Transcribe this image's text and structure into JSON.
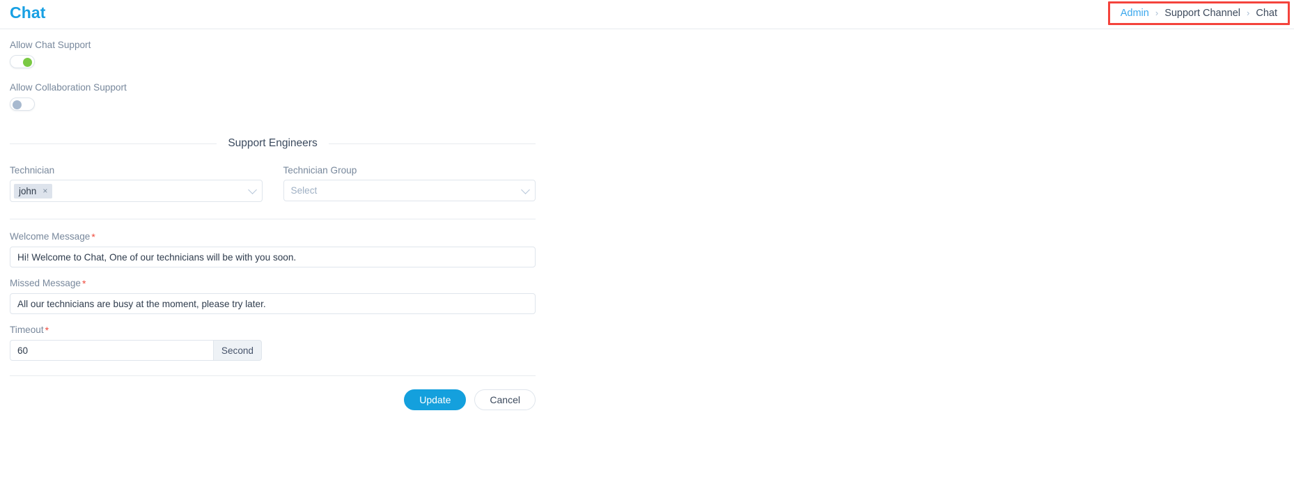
{
  "header": {
    "title": "Chat",
    "breadcrumb": {
      "items": [
        "Admin",
        "Support Channel",
        "Chat"
      ],
      "separator": "›",
      "highlight_color": "#f4433c",
      "link_color": "#39a7ed"
    }
  },
  "toggles": {
    "chat_support": {
      "label": "Allow Chat Support",
      "state": "on",
      "on_color": "#7ac943"
    },
    "collaboration_support": {
      "label": "Allow Collaboration Support",
      "state": "off",
      "off_color": "#a7b9cf"
    }
  },
  "section": {
    "title": "Support Engineers"
  },
  "technician": {
    "label": "Technician",
    "chips": [
      "john"
    ],
    "remove_glyph": "×"
  },
  "technician_group": {
    "label": "Technician Group",
    "placeholder": "Select",
    "value": ""
  },
  "welcome_message": {
    "label": "Welcome Message",
    "required": "*",
    "value": "Hi! Welcome to Chat, One of our technicians will be with you soon."
  },
  "missed_message": {
    "label": "Missed Message",
    "required": "*",
    "value": "All our technicians are busy at the moment, please try later."
  },
  "timeout": {
    "label": "Timeout",
    "required": "*",
    "value": "60",
    "unit": "Second"
  },
  "actions": {
    "update_label": "Update",
    "cancel_label": "Cancel",
    "primary_color": "#14a0dd"
  }
}
